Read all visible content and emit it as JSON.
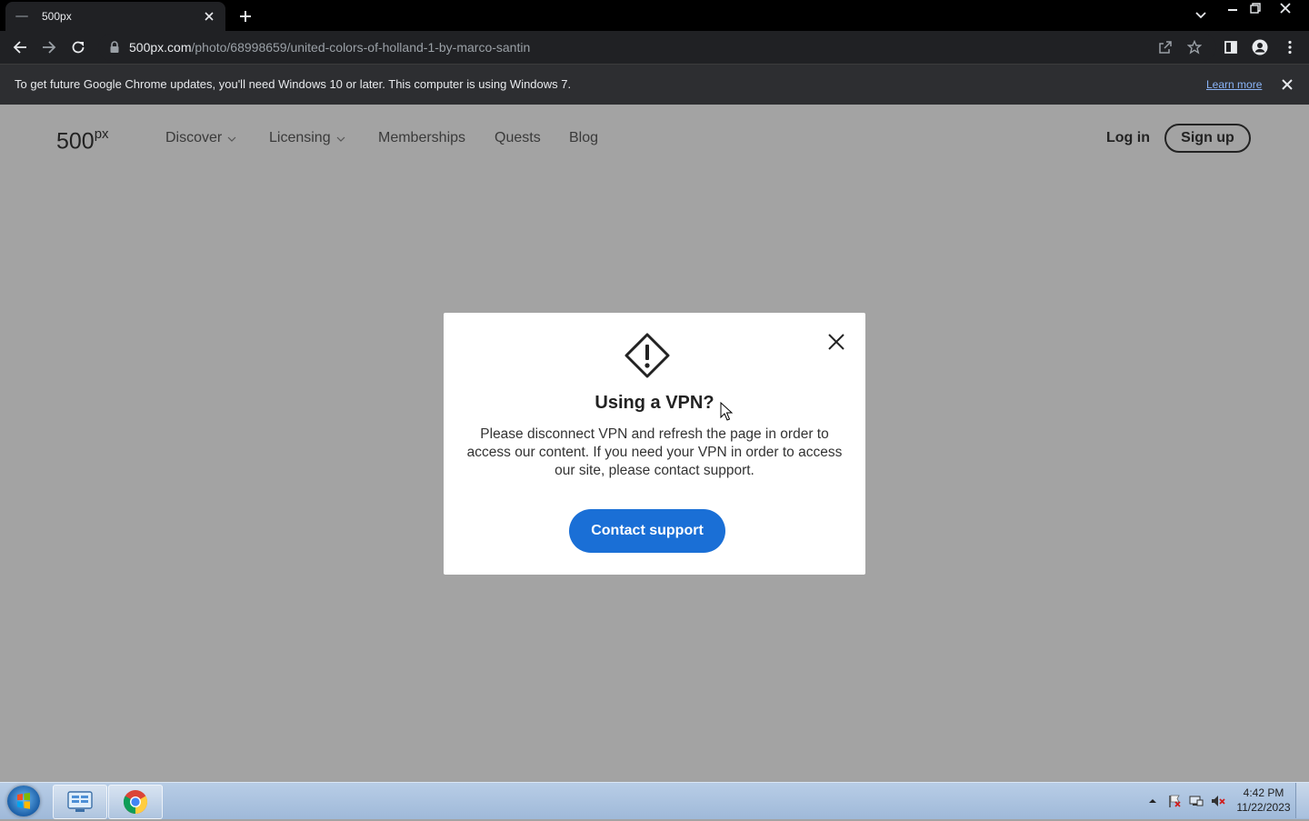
{
  "browser": {
    "tab_title": "500px",
    "url_host": "500px.com",
    "url_path": "/photo/68998659/united-colors-of-holland-1-by-marco-santin"
  },
  "infobar": {
    "message": "To get future Google Chrome updates, you'll need Windows 10 or later. This computer is using Windows 7.",
    "learn_more": "Learn more"
  },
  "site": {
    "logo": "500",
    "logo_sup": "px",
    "nav": [
      "Discover",
      "Licensing",
      "Memberships",
      "Quests",
      "Blog"
    ],
    "login": "Log in",
    "signup": "Sign up"
  },
  "modal": {
    "title": "Using a VPN?",
    "body": "Please disconnect VPN and refresh the page in order to access our content. If you need your VPN in order to access our site, please contact support.",
    "button": "Contact support"
  },
  "taskbar": {
    "time": "4:42 PM",
    "date": "11/22/2023"
  },
  "colors": {
    "overlay": "#a3a3a3",
    "primary_button": "#1a6fd6",
    "chrome_dark": "#202124"
  }
}
